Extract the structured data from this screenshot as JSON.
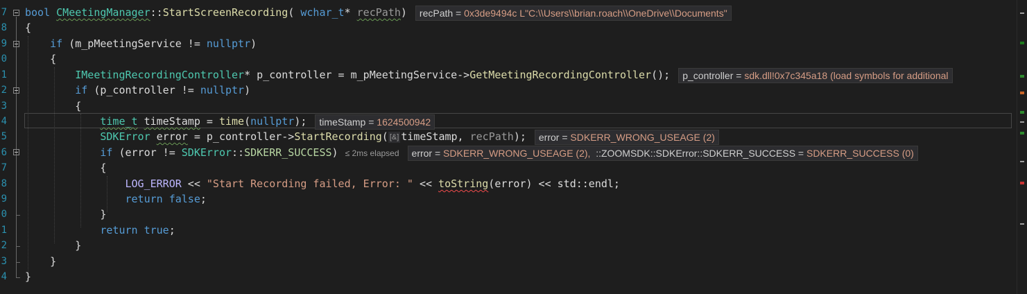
{
  "line_numbers": [
    "7",
    "8",
    "9",
    "0",
    "1",
    "2",
    "3",
    "4",
    "5",
    "6",
    "7",
    "8",
    "9",
    "0",
    "1",
    "2",
    "3",
    "4"
  ],
  "code": {
    "l1": {
      "kw": "bool",
      "class": "CMeetingManager",
      "sep": "::",
      "fn": "StartScreenRecording",
      "open": "( ",
      "ptype": "wchar_t",
      "star": "* ",
      "pname": "recPath",
      "close": ")"
    },
    "l2": {
      "t": "{"
    },
    "l3": {
      "kw": "if",
      "open": " (",
      "member": "m_pMeetingService",
      "op": " != ",
      "null": "nullptr",
      "close": ")"
    },
    "l4": {
      "t": "{"
    },
    "l5": {
      "type": "IMeetingRecordingController",
      "decl": "* p_controller = ",
      "member": "m_pMeetingService",
      "arrow": "->",
      "fn": "GetMeetingRecordingController",
      "close": "();"
    },
    "l6": {
      "kw": "if",
      "open": " (p_controller != ",
      "null": "nullptr",
      "close": ")"
    },
    "l7": {
      "t": "{"
    },
    "l8": {
      "type": "time_t",
      "var": "timeStamp",
      "eq": " = ",
      "fn": "time",
      "open": "(",
      "null": "nullptr",
      "close": ");"
    },
    "l9": {
      "type": "SDKError",
      "var": "error",
      "eq": " = p_controller->",
      "fn": "StartRecording",
      "open": "(",
      "hint": "[&]",
      "arg1": "timeStamp",
      "comma": ", ",
      "arg2": "recPath",
      "close": ");"
    },
    "l10": {
      "kw": "if",
      "open": " (error != ",
      "type": "SDKError",
      "sep": "::",
      "enum": "SDKERR_SUCCESS",
      "close": ")"
    },
    "l11": {
      "t": "{"
    },
    "l12": {
      "macro": "LOG_ERROR",
      "op": " << ",
      "str": "\"Start Recording failed, Error: \"",
      "op2": " << ",
      "fn": "toString",
      "args": "(error)",
      "op3": " << std::endl;"
    },
    "l13": {
      "kw": "return",
      "sp": " ",
      "val": "false",
      "semi": ";"
    },
    "l14": {
      "t": "}"
    },
    "l15": {
      "kw": "return",
      "sp": " ",
      "val": "true",
      "semi": ";"
    },
    "l16": {
      "t": "}"
    },
    "l17": {
      "t": "}"
    },
    "l18": {
      "t": "}"
    }
  },
  "datatips": {
    "recpath": {
      "name": "recPath = ",
      "value": "0x3de9494c L\"C:\\\\Users\\\\brian.roach\\\\OneDrive\\\\Documents\""
    },
    "pcontroller": {
      "name": "p_controller = ",
      "value": "sdk.dll!0x7c345a18 (load symbols for additional"
    },
    "timestamp": {
      "name": "timeStamp = ",
      "value": "1624500942"
    },
    "error": {
      "name": "error = ",
      "value": "SDKERR_WRONG_USEAGE (2)"
    },
    "condition": {
      "name": "error = ",
      "value": "SDKERR_WRONG_USEAGE (2),",
      "name2": "  ::ZOOMSDK::SDKError::SDKERR_SUCCESS = ",
      "value2": "SDKERR_SUCCESS (0)"
    }
  },
  "elapsed": "≤ 2ms elapsed",
  "colors": {
    "background": "#1e1e1e",
    "keyword": "#569cd6",
    "type": "#4ec9b0",
    "function": "#dcdcaa",
    "string": "#d69d85",
    "line_number": "#2b91af"
  }
}
